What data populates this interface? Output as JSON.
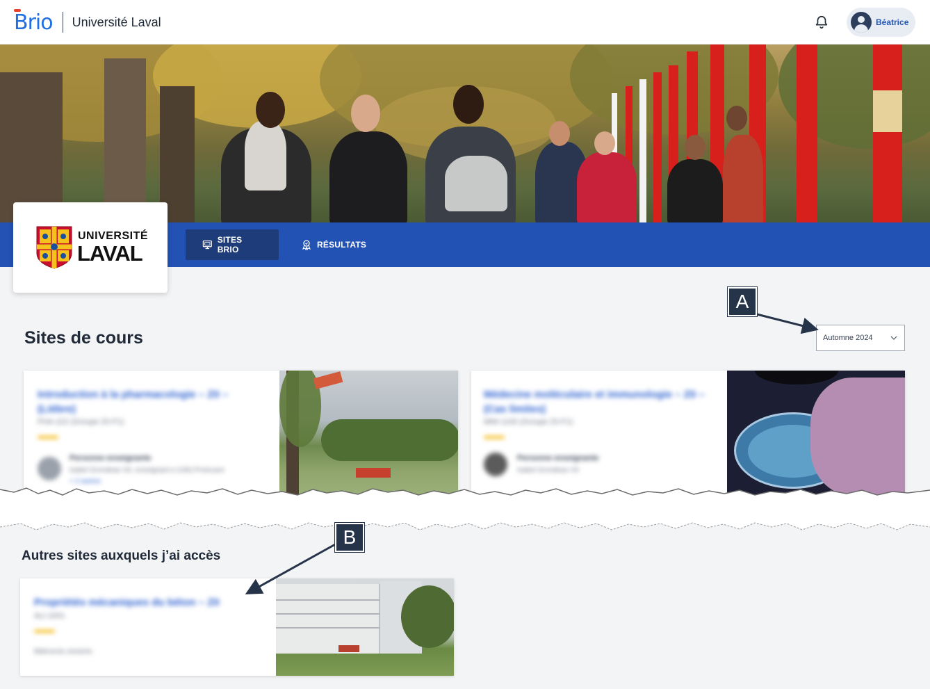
{
  "header": {
    "app_name": "Brio",
    "org_name": "Université Laval",
    "user_name": "Béatrice",
    "notifications_icon": "bell-icon"
  },
  "logo": {
    "line1": "UNIVERSITÉ",
    "line2": "LAVAL"
  },
  "nav": {
    "tabs": [
      {
        "label": "SITES BRIO",
        "icon": "monitor-icon",
        "active": true
      },
      {
        "label": "RÉSULTATS",
        "icon": "award-icon",
        "active": false
      }
    ]
  },
  "courses_section": {
    "title": "Sites de cours",
    "session_select": {
      "value": "Automne 2024"
    },
    "cards": [
      {
        "title": "Introduction à la pharmacologie – Z0 – (Lièbre)",
        "code": "PHA-222 (Groupe Z0-F1)",
        "person": "Personne enseignante",
        "sub": "Isabel Grondeau Vé, enseignant·e (Ulé) Protocare",
        "link": "+ 2 autres"
      },
      {
        "title": "Médecine moléculaire et immunologie – Z0 – (Cas limites)",
        "code": "MMI-1100 (Groupe Z0-F1)",
        "person": "Personne enseignante",
        "sub": "Isabel Grondeau Vé"
      }
    ]
  },
  "other_section": {
    "title": "Autres sites auxquels j’ai accès",
    "cards": [
      {
        "title": "Propriétés mécaniques du béton – Z0",
        "code": "ALI-1001",
        "sub": "Bâtiments sinistrés"
      }
    ]
  },
  "callouts": {
    "a": "A",
    "b": "B"
  },
  "colors": {
    "brand_blue": "#2352b5",
    "active_tab": "#1e3c7a",
    "link_blue": "#2a5fd0",
    "accent_yellow": "#f3b70a",
    "callout_bg": "#253449"
  }
}
